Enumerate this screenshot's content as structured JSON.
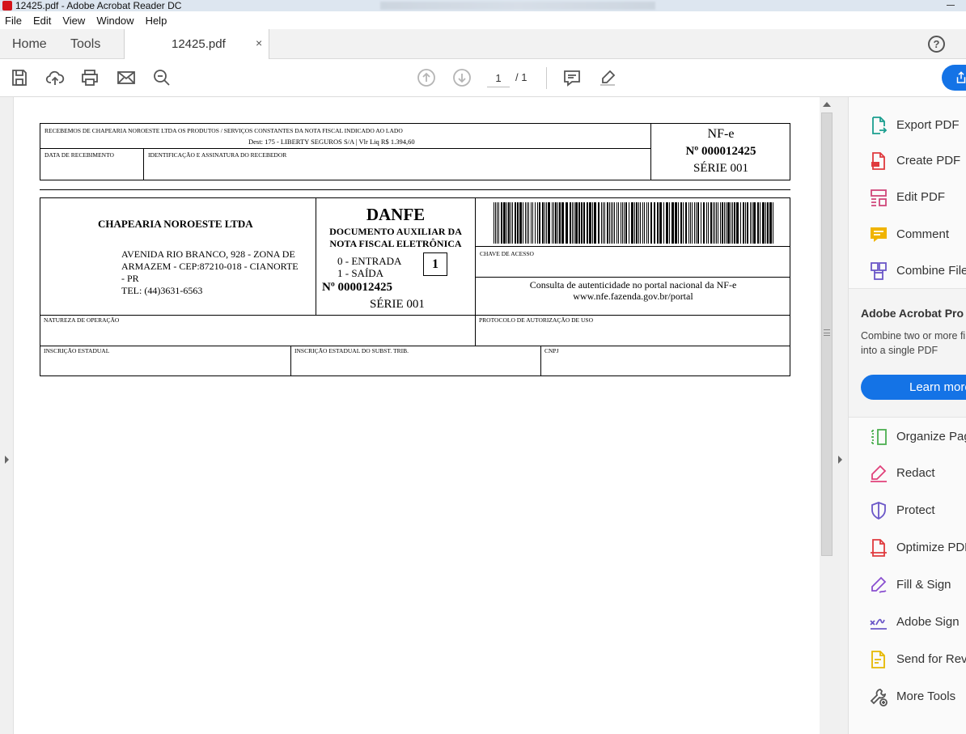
{
  "window": {
    "title": "12425.pdf - Adobe Acrobat Reader DC"
  },
  "menu": [
    "File",
    "Edit",
    "View",
    "Window",
    "Help"
  ],
  "tabs": {
    "home": "Home",
    "tools": "Tools",
    "document": "12425.pdf",
    "close": "×"
  },
  "help_label": "?",
  "toolbar": {
    "page_current": "1",
    "page_total": "/ 1"
  },
  "document": {
    "receipt_text": "RECEBEMOS DE CHAPEARIA NOROESTE LTDA OS PRODUTOS / SERVIÇOS CONSTANTES DA NOTA FISCAL INDICADO AO LADO",
    "receipt_dest": "Dest: 175 - LIBERTY SEGUROS S/A | Vlr Liq R$ 1.394,60",
    "date_label": "DATA DE RECEBIMENTO",
    "sign_label": "IDENTIFICAÇÃO E ASSINATURA DO RECEBEDOR",
    "nfe_label": "NF-e",
    "nfe_number": "Nº 000012425",
    "nfe_series": "SÉRIE 001",
    "company_name": "CHAPEARIA NOROESTE LTDA",
    "company_address_1": "AVENIDA RIO BRANCO, 928  - ZONA DE",
    "company_address_2": "ARMAZEM - CEP:87210-018 - CIANORTE",
    "company_address_3": "- PR",
    "company_phone": "TEL: (44)3631-6563",
    "danfe_title": "DANFE",
    "danfe_sub_1": "DOCUMENTO AUXILIAR DA",
    "danfe_sub_2": "NOTA FISCAL ELETRÔNICA",
    "entry_label": "0 - ENTRADA",
    "exit_label": "1 - SAÍDA",
    "operation_type": "1",
    "danfe_number": "Nº 000012425",
    "danfe_series": "SÉRIE 001",
    "access_key_label": "CHAVE DE ACESSO",
    "consult_text_1": "Consulta de autenticidade no portal nacional da NF-e",
    "consult_text_2": "www.nfe.fazenda.gov.br/portal",
    "nature_label": "NATUREZA DE OPERAÇÃO",
    "protocol_label": "PROTOCOLO DE AUTORIZAÇÃO DE USO",
    "state_reg_label": "INSCRIÇÃO ESTADUAL",
    "state_reg_subst_label": "INSCRIÇÃO ESTADUAL DO SUBST. TRIB.",
    "cnpj_label": "CNPJ"
  },
  "right_panel": {
    "tools_top": [
      {
        "label": "Export PDF",
        "icon": "export-pdf-icon",
        "color": "#1a9e8f"
      },
      {
        "label": "Create PDF",
        "icon": "create-pdf-icon",
        "color": "#e03a3e"
      },
      {
        "label": "Edit PDF",
        "icon": "edit-pdf-icon",
        "color": "#d0467a"
      },
      {
        "label": "Comment",
        "icon": "comment-icon",
        "color": "#f0b400"
      },
      {
        "label": "Combine Files",
        "icon": "combine-files-icon",
        "color": "#6b57c8"
      }
    ],
    "promo": {
      "title": "Adobe Acrobat Pro DC",
      "description": "Combine two or more files into a single PDF",
      "button": "Learn more"
    },
    "tools_bottom": [
      {
        "label": "Organize Pages",
        "icon": "organize-pages-icon",
        "color": "#4caf50"
      },
      {
        "label": "Redact",
        "icon": "redact-icon",
        "color": "#e0417a"
      },
      {
        "label": "Protect",
        "icon": "protect-icon",
        "color": "#6b57c8"
      },
      {
        "label": "Optimize PDF",
        "icon": "optimize-pdf-icon",
        "color": "#e03a3e"
      },
      {
        "label": "Fill & Sign",
        "icon": "fill-sign-icon",
        "color": "#8a4fd0"
      },
      {
        "label": "Adobe Sign",
        "icon": "adobe-sign-icon",
        "color": "#6b57c8"
      },
      {
        "label": "Send for Review",
        "icon": "send-review-icon",
        "color": "#e6b800"
      },
      {
        "label": "More Tools",
        "icon": "more-tools-icon",
        "color": "#555555"
      }
    ]
  }
}
